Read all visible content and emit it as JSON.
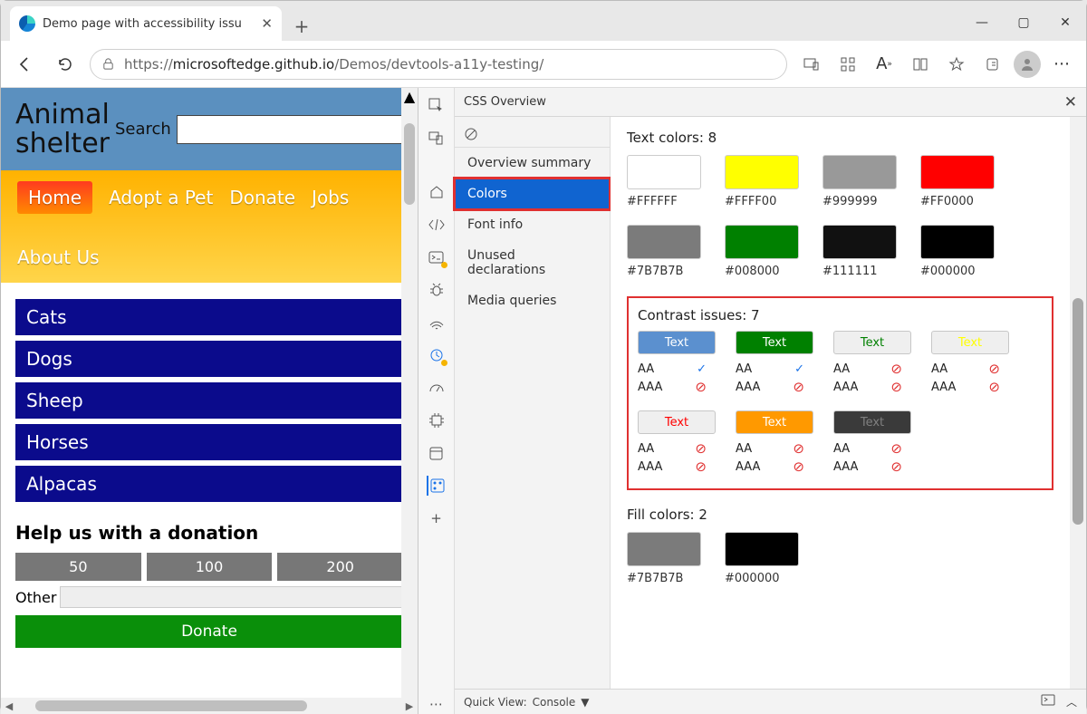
{
  "window": {
    "tab_title": "Demo page with accessibility issu",
    "minimize": "—",
    "maximize": "▢",
    "close": "✕"
  },
  "toolbar": {
    "url_pre": "https://",
    "url_host": "microsoftedge.github.io",
    "url_path": "/Demos/devtools-a11y-testing/"
  },
  "demo": {
    "title_l1": "Animal",
    "title_l2": "shelter",
    "search_label": "Search",
    "nav": {
      "home": "Home",
      "adopt": "Adopt a Pet",
      "donate": "Donate",
      "jobs": "Jobs",
      "about": "About Us"
    },
    "animals": [
      "Cats",
      "Dogs",
      "Sheep",
      "Horses",
      "Alpacas"
    ],
    "donation": {
      "heading": "Help us with a donation",
      "amounts": [
        "50",
        "100",
        "200"
      ],
      "other_label": "Other",
      "donate_btn": "Donate"
    }
  },
  "devtools": {
    "panel_title": "CSS Overview",
    "sidebar": {
      "items": [
        "Overview summary",
        "Colors",
        "Font info",
        "Unused declarations",
        "Media queries"
      ],
      "selected": "Colors"
    },
    "text_colors": {
      "label": "Text colors: 8",
      "swatches": [
        {
          "hex": "#FFFFFF"
        },
        {
          "hex": "#FFFF00"
        },
        {
          "hex": "#999999"
        },
        {
          "hex": "#FF0000"
        },
        {
          "hex": "#7B7B7B"
        },
        {
          "hex": "#008000"
        },
        {
          "hex": "#111111"
        },
        {
          "hex": "#000000"
        }
      ]
    },
    "contrast": {
      "label": "Contrast issues: 7",
      "sample_text": "Text",
      "aa": "AA",
      "aaa": "AAA",
      "items": [
        {
          "bg": "#5b90cf",
          "fg": "#ffffff",
          "aa": "ok",
          "aaa": "no"
        },
        {
          "bg": "#008000",
          "fg": "#ffffff",
          "aa": "ok",
          "aaa": "no"
        },
        {
          "bg": "#efefef",
          "fg": "#008000",
          "aa": "no",
          "aaa": "no"
        },
        {
          "bg": "#efefef",
          "fg": "#ffff00",
          "aa": "no",
          "aaa": "no"
        },
        {
          "bg": "#efefef",
          "fg": "#ff0000",
          "aa": "no",
          "aaa": "no"
        },
        {
          "bg": "#ff9900",
          "fg": "#ffffff",
          "aa": "no",
          "aaa": "no"
        },
        {
          "bg": "#3a3a3a",
          "fg": "#808080",
          "aa": "no",
          "aaa": "no"
        }
      ]
    },
    "fill_colors": {
      "label": "Fill colors: 2",
      "swatches": [
        {
          "hex": "#7B7B7B"
        },
        {
          "hex": "#000000"
        }
      ]
    },
    "quickview": {
      "label": "Quick View:",
      "value": "Console"
    }
  }
}
